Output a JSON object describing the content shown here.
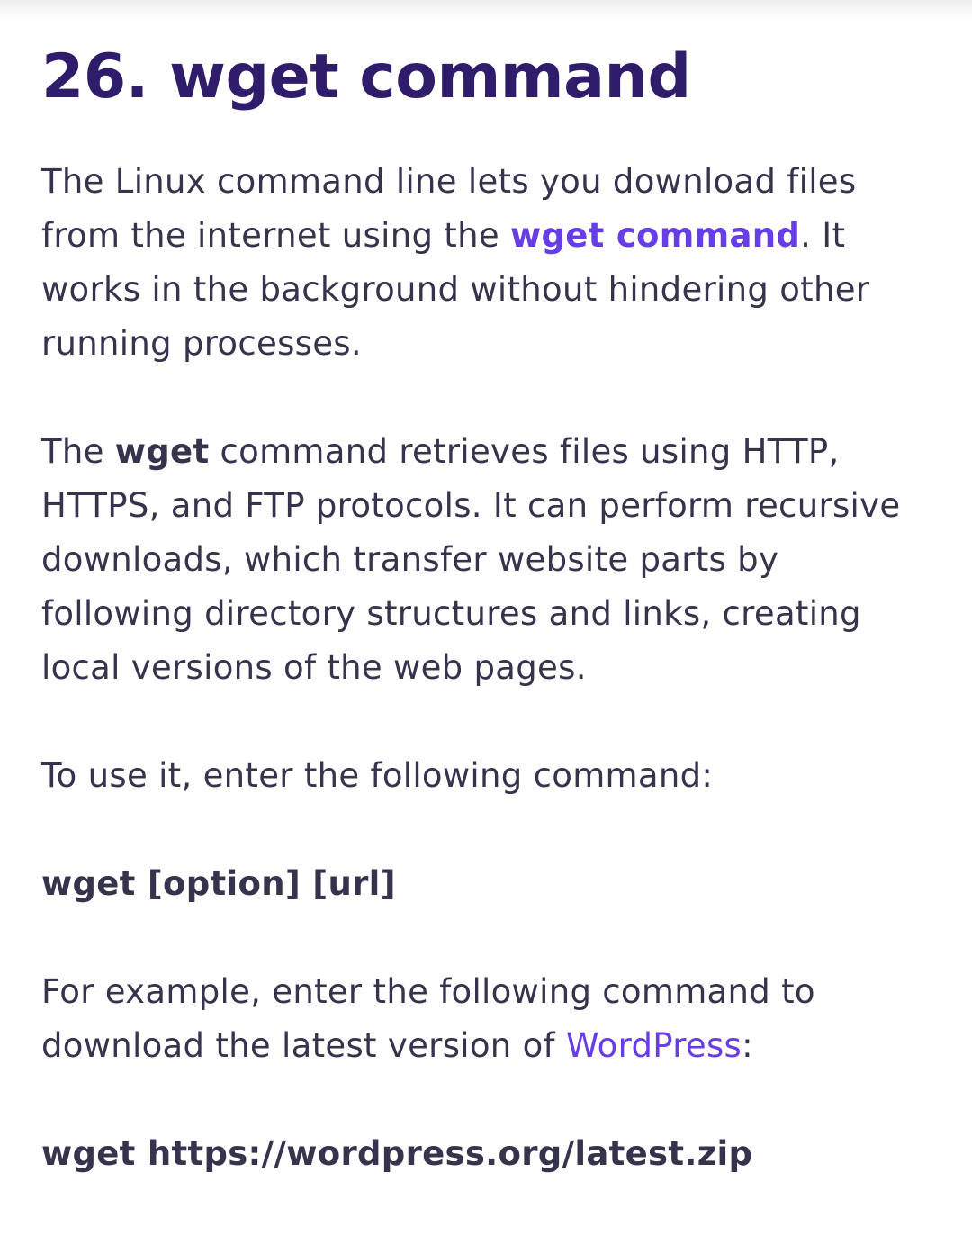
{
  "heading": "26. wget command",
  "p1": {
    "before_link": "The Linux command line lets you download files from the internet using the ",
    "link": "wget command",
    "after_link": ". It works in the background without hindering other running processes."
  },
  "p2": {
    "before_bold": "The ",
    "bold": "wget",
    "after_bold": " command retrieves files using HTTP, HTTPS, and FTP protocols. It can perform recursive downloads, which transfer website parts by following directory structures and links, creating local versions of the web pages."
  },
  "p3": "To use it, enter the following command:",
  "p4": "wget [option] [url]",
  "p5": {
    "before_link": "For example, enter the following command to download the latest version of ",
    "link": "WordPress",
    "after_link": ":"
  },
  "p6": "wget https://wordpress.org/latest.zip",
  "colors": {
    "heading": "#2f1c6a",
    "body_text": "#36344d",
    "link": "#673de6",
    "background": "#ffffff"
  }
}
